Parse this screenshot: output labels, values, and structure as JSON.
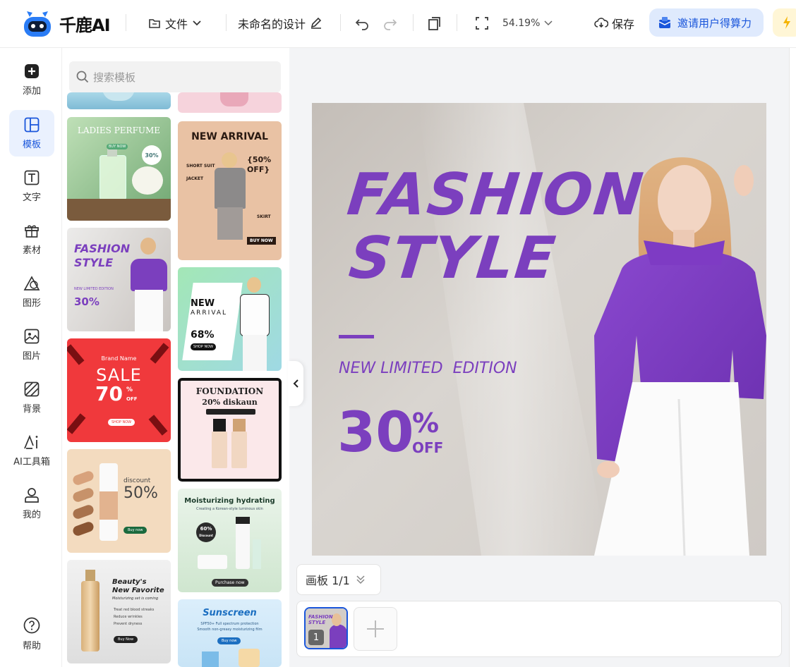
{
  "app": {
    "brand": "千鹿AI"
  },
  "toolbar": {
    "file_label": "文件",
    "design_name": "未命名的设计",
    "zoom_level": "54.19%",
    "save_label": "保存",
    "invite_label": "邀请用户得算力"
  },
  "sidebar": {
    "items": [
      {
        "label": "添加"
      },
      {
        "label": "模板"
      },
      {
        "label": "文字"
      },
      {
        "label": "素材"
      },
      {
        "label": "图形"
      },
      {
        "label": "图片"
      },
      {
        "label": "背景"
      },
      {
        "label": "AI工具箱"
      },
      {
        "label": "我的"
      }
    ],
    "help_label": "帮助"
  },
  "panel": {
    "search_placeholder": "搜索模板",
    "templates": [
      {
        "title": "LADIES PERFUME",
        "badge": "30%",
        "button": "BUY NOW"
      },
      {
        "title": "NEW ARRIVAL",
        "offer": "{50% OFF}",
        "tags": [
          "SHORT SUIT",
          "JACKET",
          "SKIRT"
        ],
        "button": "BUY NOW"
      },
      {
        "title1": "FASHION",
        "title2": "STYLE",
        "sub": "NEW LIMITED EDITION",
        "offer": "30%"
      },
      {
        "title1": "NEW",
        "title2": "ARRIVAL",
        "offer": "68%",
        "button": "SHOP NOW"
      },
      {
        "brand": "Brand Name",
        "title": "SALE",
        "offer": "70",
        "button": "SHOP NOW"
      },
      {
        "title1": "FOUNDATION",
        "title2": "20% diskaun"
      },
      {
        "label": "discount",
        "offer": "50%",
        "button": "Buy now"
      },
      {
        "title": "Moisturizing hydrating",
        "sub": "Creating a Korean-style luminous skin",
        "badge1": "60%",
        "badge2": "Discount",
        "button": "Purchase now"
      },
      {
        "title1": "Beauty's",
        "title2": "New Favorite",
        "sub": "Moisturizing set is coming",
        "bullets": [
          "Treat red blood streaks",
          "Reduce wrinkles",
          "Prevent dryness"
        ],
        "button": "Buy Now"
      },
      {
        "title": "Sunscreen",
        "sub1": "SPF50+ Full spectrum protection",
        "sub2": "Smooth non-greasy moisturizing film",
        "button": "Buy now"
      }
    ]
  },
  "canvas": {
    "title1": "FASHION",
    "title2": "STYLE",
    "subtitle": "NEW LIMITED  EDITION",
    "discount_value": "30",
    "discount_pct": "%",
    "discount_off": "OFF",
    "accent_color": "#7b3fbe"
  },
  "artboard": {
    "label": "画板 1/1",
    "page_number": "1"
  },
  "thumb": {
    "title1": "FASHION",
    "title2": "STYLE"
  }
}
